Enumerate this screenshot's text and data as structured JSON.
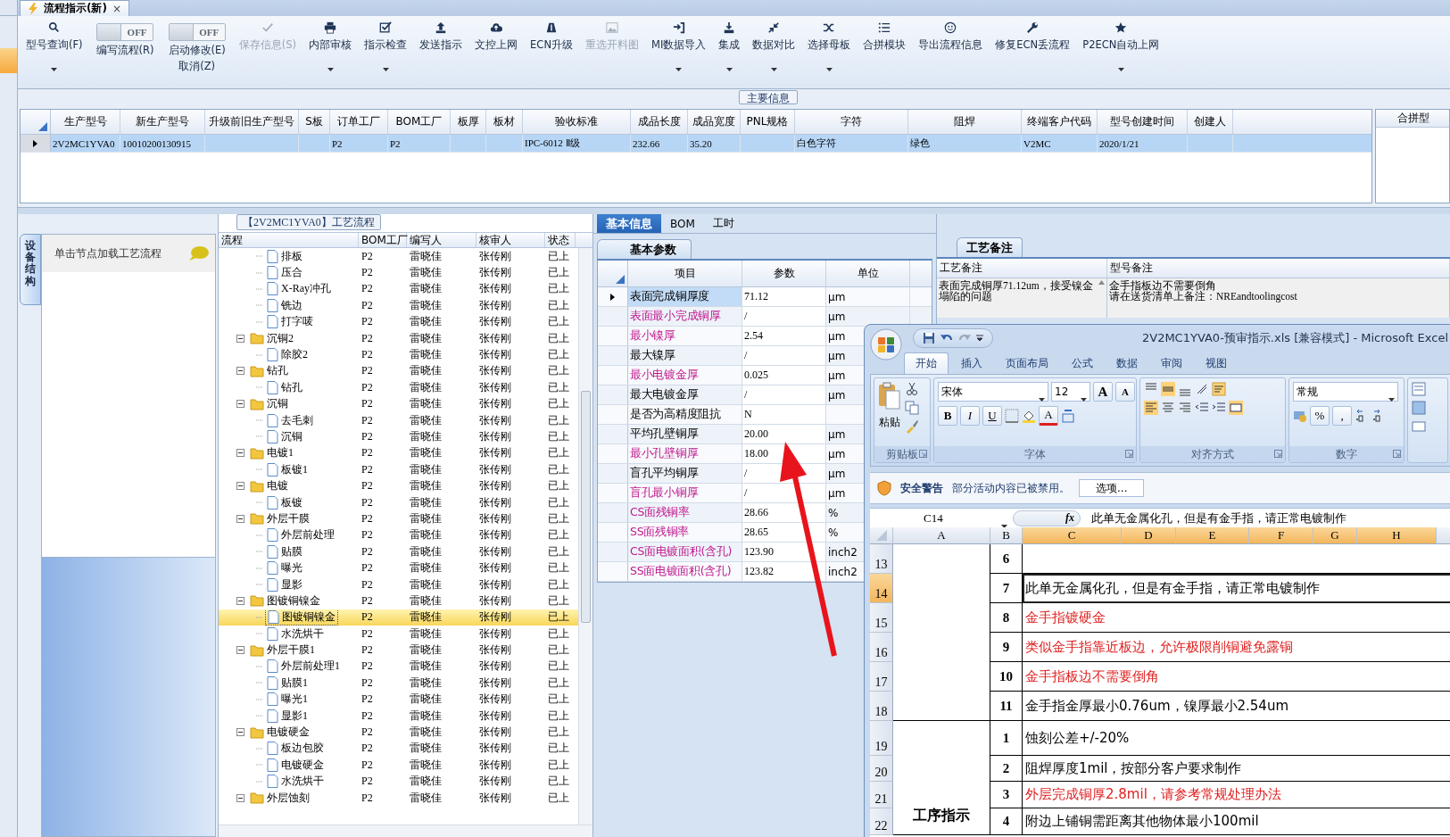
{
  "doc_tab": {
    "title": "流程指示(新)",
    "close": "×"
  },
  "toolbar": {
    "items": [
      {
        "kind": "button",
        "label": "型号查询(F)",
        "dropdown": true,
        "disabled": false
      },
      {
        "kind": "toggle",
        "label": "编写流程(R)",
        "state_text": "OFF",
        "on": false
      },
      {
        "kind": "toggle",
        "label": "启动修改(E)",
        "label_2": "取消(Z)",
        "state_text": "OFF",
        "on": false
      },
      {
        "kind": "button",
        "label": "保存信息(S)",
        "dropdown": false,
        "disabled": true
      },
      {
        "kind": "button",
        "label": "内部审核",
        "dropdown": true,
        "disabled": false
      },
      {
        "kind": "button",
        "label": "指示检查",
        "dropdown": true,
        "disabled": false
      },
      {
        "kind": "button",
        "label": "发送指示",
        "dropdown": false,
        "disabled": false
      },
      {
        "kind": "button",
        "label": "文控上网",
        "dropdown": false,
        "disabled": false
      },
      {
        "kind": "button",
        "label": "ECN升级",
        "dropdown": false,
        "disabled": false
      },
      {
        "kind": "button",
        "label": "重选开料图",
        "dropdown": false,
        "disabled": true
      },
      {
        "kind": "button",
        "label": "MI数据导入",
        "dropdown": true,
        "disabled": false
      },
      {
        "kind": "button",
        "label": "集成",
        "dropdown": true,
        "disabled": false
      },
      {
        "kind": "button",
        "label": "数据对比",
        "dropdown": true,
        "disabled": false
      },
      {
        "kind": "button",
        "label": "选择母板",
        "dropdown": true,
        "disabled": false
      },
      {
        "kind": "button",
        "label": "合拼模块",
        "dropdown": false,
        "disabled": false
      },
      {
        "kind": "button",
        "label": "导出流程信息",
        "dropdown": false,
        "disabled": false
      },
      {
        "kind": "button",
        "label": "修复ECN丢流程",
        "dropdown": false,
        "disabled": false
      },
      {
        "kind": "button",
        "label": "P2ECN自动上网",
        "dropdown": true,
        "disabled": false
      }
    ]
  },
  "main_info": {
    "group_title": "主要信息",
    "columns": [
      "生产型号",
      "新生产型号",
      "升级前旧生产型号",
      "S板",
      "订单工厂",
      "BOM工厂",
      "板厚",
      "板材",
      "验收标准",
      "成品长度",
      "成品宽度",
      "PNL规格",
      "字符",
      "阻焊",
      "终端客户代码",
      "型号创建时间",
      "创建人"
    ],
    "rows": [
      {
        "selected": true,
        "cells": [
          "2V2MC1YVA0",
          "10010200130915",
          null,
          null,
          "P2",
          "P2",
          null,
          null,
          "IPC-6012 Ⅱ级",
          "232.66",
          "35.20",
          null,
          "白色字符",
          "绿色",
          "V2MC",
          "2020/1/21",
          null
        ]
      }
    ],
    "side_header": "合拼型"
  },
  "left_panel": {
    "tabs": [
      {
        "label": "设备结构",
        "selected": true
      }
    ],
    "header": "单击节点加载工艺流程"
  },
  "flow": {
    "title": "【2V2MC1YVA0】工艺流程",
    "columns": [
      "流程",
      "BOM工厂",
      "编写人",
      "核审人",
      "状态"
    ],
    "nodes": [
      {
        "kind": "step",
        "label": "排板",
        "bom_factory": "P2",
        "writer": "雷晓佳",
        "reviewer": "张传刚",
        "status": "已上",
        "selected": false
      },
      {
        "kind": "step",
        "label": "压合",
        "bom_factory": "P2",
        "writer": "雷晓佳",
        "reviewer": "张传刚",
        "status": "已上",
        "selected": false
      },
      {
        "kind": "step",
        "label": "X-Ray冲孔",
        "bom_factory": "P2",
        "writer": "雷晓佳",
        "reviewer": "张传刚",
        "status": "已上",
        "selected": false
      },
      {
        "kind": "step",
        "label": "铣边",
        "bom_factory": "P2",
        "writer": "雷晓佳",
        "reviewer": "张传刚",
        "status": "已上",
        "selected": false
      },
      {
        "kind": "step",
        "label": "打字唛",
        "bom_factory": "P2",
        "writer": "雷晓佳",
        "reviewer": "张传刚",
        "status": "已上",
        "selected": false
      },
      {
        "kind": "folder",
        "label": "沉铜2",
        "bom_factory": "P2",
        "writer": "雷晓佳",
        "reviewer": "张传刚",
        "status": "已上",
        "selected": false,
        "expanded": true,
        "children": [
          {
            "kind": "step",
            "label": "除胶2",
            "bom_factory": "P2",
            "writer": "雷晓佳",
            "reviewer": "张传刚",
            "status": "已上",
            "selected": false
          }
        ]
      },
      {
        "kind": "folder",
        "label": "钻孔",
        "bom_factory": "P2",
        "writer": "雷晓佳",
        "reviewer": "张传刚",
        "status": "已上",
        "selected": false,
        "expanded": true,
        "children": [
          {
            "kind": "step",
            "label": "钻孔",
            "bom_factory": "P2",
            "writer": "雷晓佳",
            "reviewer": "张传刚",
            "status": "已上",
            "selected": false
          }
        ]
      },
      {
        "kind": "folder",
        "label": "沉铜",
        "bom_factory": "P2",
        "writer": "雷晓佳",
        "reviewer": "张传刚",
        "status": "已上",
        "selected": false,
        "expanded": true,
        "children": [
          {
            "kind": "step",
            "label": "去毛刺",
            "bom_factory": "P2",
            "writer": "雷晓佳",
            "reviewer": "张传刚",
            "status": "已上",
            "selected": false
          },
          {
            "kind": "step",
            "label": "沉铜",
            "bom_factory": "P2",
            "writer": "雷晓佳",
            "reviewer": "张传刚",
            "status": "已上",
            "selected": false
          }
        ]
      },
      {
        "kind": "folder",
        "label": "电镀1",
        "bom_factory": "P2",
        "writer": "雷晓佳",
        "reviewer": "张传刚",
        "status": "已上",
        "selected": false,
        "expanded": true,
        "children": [
          {
            "kind": "step",
            "label": "板镀1",
            "bom_factory": "P2",
            "writer": "雷晓佳",
            "reviewer": "张传刚",
            "status": "已上",
            "selected": false
          }
        ]
      },
      {
        "kind": "folder",
        "label": "电镀",
        "bom_factory": "P2",
        "writer": "雷晓佳",
        "reviewer": "张传刚",
        "status": "已上",
        "selected": false,
        "expanded": true,
        "children": [
          {
            "kind": "step",
            "label": "板镀",
            "bom_factory": "P2",
            "writer": "雷晓佳",
            "reviewer": "张传刚",
            "status": "已上",
            "selected": false
          }
        ]
      },
      {
        "kind": "folder",
        "label": "外层干膜",
        "bom_factory": "P2",
        "writer": "雷晓佳",
        "reviewer": "张传刚",
        "status": "已上",
        "selected": false,
        "expanded": true,
        "children": [
          {
            "kind": "step",
            "label": "外层前处理",
            "bom_factory": "P2",
            "writer": "雷晓佳",
            "reviewer": "张传刚",
            "status": "已上",
            "selected": false
          },
          {
            "kind": "step",
            "label": "贴膜",
            "bom_factory": "P2",
            "writer": "雷晓佳",
            "reviewer": "张传刚",
            "status": "已上",
            "selected": false
          },
          {
            "kind": "step",
            "label": "曝光",
            "bom_factory": "P2",
            "writer": "雷晓佳",
            "reviewer": "张传刚",
            "status": "已上",
            "selected": false
          },
          {
            "kind": "step",
            "label": "显影",
            "bom_factory": "P2",
            "writer": "雷晓佳",
            "reviewer": "张传刚",
            "status": "已上",
            "selected": false
          }
        ]
      },
      {
        "kind": "folder",
        "label": "图镀铜镍金",
        "bom_factory": "P2",
        "writer": "雷晓佳",
        "reviewer": "张传刚",
        "status": "已上",
        "selected": false,
        "expanded": true,
        "children": [
          {
            "kind": "step",
            "label": "图镀铜镍金",
            "bom_factory": "P2",
            "writer": "雷晓佳",
            "reviewer": "张传刚",
            "status": "已上",
            "selected": true
          },
          {
            "kind": "step",
            "label": "水洗烘干",
            "bom_factory": "P2",
            "writer": "雷晓佳",
            "reviewer": "张传刚",
            "status": "已上",
            "selected": false
          }
        ]
      },
      {
        "kind": "folder",
        "label": "外层干膜1",
        "bom_factory": "P2",
        "writer": "雷晓佳",
        "reviewer": "张传刚",
        "status": "已上",
        "selected": false,
        "expanded": true,
        "children": [
          {
            "kind": "step",
            "label": "外层前处理1",
            "bom_factory": "P2",
            "writer": "雷晓佳",
            "reviewer": "张传刚",
            "status": "已上",
            "selected": false
          },
          {
            "kind": "step",
            "label": "贴膜1",
            "bom_factory": "P2",
            "writer": "雷晓佳",
            "reviewer": "张传刚",
            "status": "已上",
            "selected": false
          },
          {
            "kind": "step",
            "label": "曝光1",
            "bom_factory": "P2",
            "writer": "雷晓佳",
            "reviewer": "张传刚",
            "status": "已上",
            "selected": false
          },
          {
            "kind": "step",
            "label": "显影1",
            "bom_factory": "P2",
            "writer": "雷晓佳",
            "reviewer": "张传刚",
            "status": "已上",
            "selected": false
          }
        ]
      },
      {
        "kind": "folder",
        "label": "电镀硬金",
        "bom_factory": "P2",
        "writer": "雷晓佳",
        "reviewer": "张传刚",
        "status": "已上",
        "selected": false,
        "expanded": true,
        "children": [
          {
            "kind": "step",
            "label": "板边包胶",
            "bom_factory": "P2",
            "writer": "雷晓佳",
            "reviewer": "张传刚",
            "status": "已上",
            "selected": false
          },
          {
            "kind": "step",
            "label": "电镀硬金",
            "bom_factory": "P2",
            "writer": "雷晓佳",
            "reviewer": "张传刚",
            "status": "已上",
            "selected": false
          },
          {
            "kind": "step",
            "label": "水洗烘干",
            "bom_factory": "P2",
            "writer": "雷晓佳",
            "reviewer": "张传刚",
            "status": "已上",
            "selected": false
          }
        ]
      },
      {
        "kind": "folder",
        "label": "外层蚀刻",
        "bom_factory": "P2",
        "writer": "雷晓佳",
        "reviewer": "张传刚",
        "status": "已上",
        "selected": false,
        "expanded": true
      }
    ]
  },
  "info_tabs": [
    {
      "label": "基本信息",
      "selected": true
    },
    {
      "label": "BOM",
      "selected": false
    },
    {
      "label": "工时",
      "selected": false
    }
  ],
  "params": {
    "tab": "基本参数",
    "columns": [
      "项目",
      "参数",
      "单位"
    ],
    "rows": [
      {
        "name": "表面完成铜厚度",
        "value": "71.12",
        "unit": "μm",
        "highlighted": false,
        "selected": true
      },
      {
        "name": "表面最小完成铜厚",
        "value": "/",
        "unit": "μm",
        "highlighted": true,
        "selected": false
      },
      {
        "name": "最小镍厚",
        "value": "2.54",
        "unit": "μm",
        "highlighted": true,
        "selected": false
      },
      {
        "name": "最大镍厚",
        "value": "/",
        "unit": "μm",
        "highlighted": false,
        "selected": false
      },
      {
        "name": "最小电镀金厚",
        "value": "0.025",
        "unit": "μm",
        "highlighted": true,
        "selected": false
      },
      {
        "name": "最大电镀金厚",
        "value": "/",
        "unit": "μm",
        "highlighted": false,
        "selected": false
      },
      {
        "name": "是否为高精度阻抗",
        "value": "N",
        "highlighted": false,
        "selected": false
      },
      {
        "name": "平均孔壁铜厚",
        "value": "20.00",
        "unit": "μm",
        "highlighted": false,
        "selected": false
      },
      {
        "name": "最小孔壁铜厚",
        "value": "18.00",
        "unit": "μm",
        "highlighted": true,
        "selected": false
      },
      {
        "name": "盲孔平均铜厚",
        "value": "/",
        "unit": "μm",
        "highlighted": false,
        "selected": false
      },
      {
        "name": "盲孔最小铜厚",
        "value": "/",
        "unit": "μm",
        "highlighted": true,
        "selected": false
      },
      {
        "name": "CS面残铜率",
        "value": "28.66",
        "unit": "%",
        "highlighted": true,
        "selected": false
      },
      {
        "name": "SS面残铜率",
        "value": "28.65",
        "unit": "%",
        "highlighted": true,
        "selected": false
      },
      {
        "name": "CS面电镀面积(含孔)",
        "value": "123.90",
        "unit": "inch2",
        "highlighted": true,
        "selected": false
      },
      {
        "name": "SS面电镀面积(含孔)",
        "value": "123.82",
        "unit": "inch2",
        "highlighted": true,
        "selected": false
      }
    ]
  },
  "notes": {
    "tab": "工艺备注",
    "columns": [
      "工艺备注",
      "型号备注"
    ],
    "process_note": "表面完成铜厚71.12um，接受镍金塌陷的问题",
    "model_note_lines": [
      "金手指板边不需要倒角",
      "请在送货清单上备注：NREandtoolingcost"
    ]
  },
  "excel": {
    "title": "2V2MC1YVA0-预审指示.xls  [兼容模式]  -  Microsoft Excel",
    "ribbon_tabs": [
      {
        "label": "开始",
        "selected": true
      },
      {
        "label": "插入",
        "selected": false
      },
      {
        "label": "页面布局",
        "selected": false
      },
      {
        "label": "公式",
        "selected": false
      },
      {
        "label": "数据",
        "selected": false
      },
      {
        "label": "审阅",
        "selected": false
      },
      {
        "label": "视图",
        "selected": false
      }
    ],
    "clipboard": {
      "label": "剪贴板",
      "paste": "粘贴"
    },
    "font": {
      "label": "字体",
      "name": "宋体",
      "size": "12",
      "size_buttons": [
        "A",
        "A"
      ],
      "style_buttons": [
        "B",
        "I",
        "U"
      ],
      "color_button": "A"
    },
    "alignment": {
      "label": "对齐方式"
    },
    "number": {
      "label": "数字",
      "format": "常规",
      "buttons": [
        "%",
        ","
      ]
    },
    "security": {
      "title": "安全警告",
      "message": "部分活动内容已被禁用。",
      "button": "选项..."
    },
    "name_box": "C14",
    "function_label": "fx",
    "formula": "此单无金属化孔，但是有金手指，请正常电镀制作",
    "columns": [
      {
        "label": "A",
        "selected": false
      },
      {
        "label": "B",
        "selected": false
      },
      {
        "label": "C",
        "selected": true
      },
      {
        "label": "D",
        "selected": true
      },
      {
        "label": "E",
        "selected": true
      },
      {
        "label": "F",
        "selected": true
      },
      {
        "label": "G",
        "selected": true
      },
      {
        "label": "H",
        "selected": true
      }
    ],
    "groups": [
      {
        "rows": [
          {
            "number": "13",
            "selected": false,
            "b": "6"
          },
          {
            "number": "14",
            "selected": true,
            "b": "7",
            "c": "此单无金属化孔，但是有金手指，请正常电镀制作",
            "color": "#000000"
          },
          {
            "number": "15",
            "selected": false,
            "b": "8",
            "c": "金手指镀硬金",
            "color": "#e02020"
          },
          {
            "number": "16",
            "selected": false,
            "b": "9",
            "c": "类似金手指靠近板边，允许极限削铜避免露铜",
            "color": "#e02020"
          },
          {
            "number": "17",
            "selected": false,
            "b": "10",
            "c": "金手指板边不需要倒角",
            "color": "#e02020"
          },
          {
            "number": "18",
            "selected": false,
            "b": "11",
            "c": "金手指金厚最小0.76um，镍厚最小2.54um",
            "color": "#000000"
          }
        ]
      },
      {
        "label": "工序指示",
        "rows": [
          {
            "number": "19",
            "selected": false,
            "b": "1",
            "c": "蚀刻公差+/-20%",
            "color": "#000000"
          },
          {
            "number": "20",
            "selected": false,
            "b": "2",
            "c": "阻焊厚度1mil，按部分客户要求制作",
            "color": "#000000"
          },
          {
            "number": "21",
            "selected": false,
            "b": "3",
            "c": "外层完成铜厚2.8mil，请参考常规处理办法",
            "color": "#e02020"
          },
          {
            "number": "22",
            "selected": false,
            "b": "4",
            "c": "附边上铺铜需距离其他物体最小100mil",
            "color": "#000000"
          }
        ]
      }
    ]
  }
}
